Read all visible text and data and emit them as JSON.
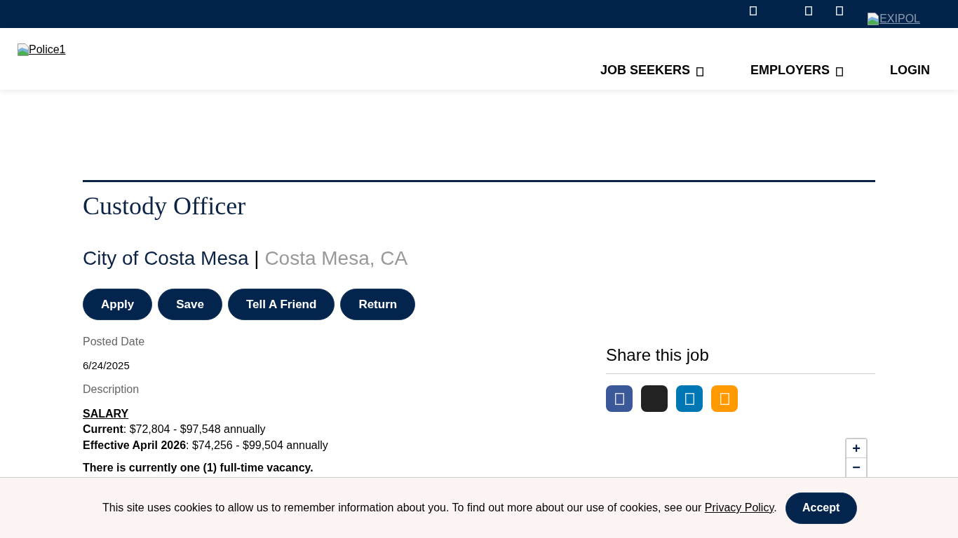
{
  "top_bar": {
    "partner_logo": {
      "alt_text": "EXIPOL"
    }
  },
  "header": {
    "logo": {
      "alt_text": "Police1"
    },
    "nav": [
      {
        "label": "JOB SEEKERS",
        "kind": "dropdown"
      },
      {
        "label": "EMPLOYERS",
        "kind": "dropdown"
      },
      {
        "label": "LOGIN",
        "kind": "link"
      }
    ]
  },
  "job": {
    "title": "Custody Officer",
    "employer": "City of Costa Mesa",
    "separator": "|",
    "location": "Costa Mesa, CA",
    "actions": [
      "Apply",
      "Save",
      "Tell A Friend",
      "Return"
    ],
    "fields": [
      {
        "label": "Posted Date",
        "value": "6/24/2025"
      }
    ],
    "description": {
      "label": "Description",
      "salary_heading": "SALARY",
      "salary_lines": [
        "**Current**: $72,804 - $97,548 annually",
        "**Effective April 2026**: $74,256 - $99,504 annually"
      ],
      "note": "There is currently one (1) full-time vacancy."
    }
  },
  "share": {
    "title": "Share this job",
    "networks": [
      {
        "color": "#3b5998",
        "glyph": true
      },
      {
        "color": "#222222",
        "glyph": false
      },
      {
        "color": "#0077b5",
        "glyph": true
      },
      {
        "color": "#ff9900",
        "glyph": true
      }
    ]
  },
  "map_controls": [
    {
      "label": "+",
      "kind": "zoom_in"
    },
    {
      "label": "−",
      "kind": "zoom_out"
    }
  ],
  "cookie_banner": {
    "text": "This site uses cookies to allow us to remember information about you. To find out more about our use of cookies, see our ",
    "link": "Privacy Policy",
    "after_link": ".",
    "button": "Accept"
  }
}
